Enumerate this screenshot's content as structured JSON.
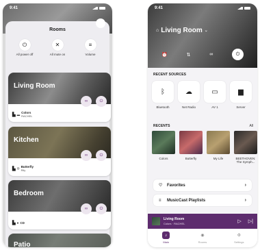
{
  "status": {
    "time": "9:41"
  },
  "left": {
    "rooms_title": "Rooms",
    "quick_actions": [
      {
        "label": "All power off",
        "icon": "power-icon",
        "glyph": "⏻"
      },
      {
        "label": "All mute on",
        "icon": "mute-icon",
        "glyph": "🔇"
      },
      {
        "label": "Volume",
        "icon": "volume-sliders-icon",
        "glyph": "≡"
      }
    ],
    "rooms": [
      {
        "name": "Living Room",
        "track": "Colors",
        "artist": "RACHEL"
      },
      {
        "name": "Kitchen",
        "track": "Butterfly",
        "artist": "Rily"
      },
      {
        "name": "Bedroom",
        "track": "CD",
        "artist": ""
      },
      {
        "name": "Patio",
        "track": "",
        "artist": ""
      }
    ]
  },
  "right": {
    "room_title": "Living Room",
    "recent_sources_label": "RECENT SOURCES",
    "sources": [
      {
        "label": "Bluetooth",
        "icon": "bluetooth-icon",
        "glyph": "ᛒ"
      },
      {
        "label": "Net Radio",
        "icon": "net-radio-icon",
        "glyph": "☁"
      },
      {
        "label": "AV 1",
        "icon": "av-input-icon",
        "glyph": "▭"
      },
      {
        "label": "Server",
        "icon": "server-folder-icon",
        "glyph": "▆"
      }
    ],
    "recents_label": "RECENTS",
    "recents_all": "All",
    "recents": [
      {
        "label": "Colors",
        "label2": ""
      },
      {
        "label": "Butterfly",
        "label2": ""
      },
      {
        "label": "My Life",
        "label2": ""
      },
      {
        "label": "BEETHOVEN:",
        "label2": "The Symph..."
      }
    ],
    "favorites_label": "Favorites",
    "playlists_label": "MusicCast Playlists",
    "mini": {
      "room": "Living Room",
      "track": "Colors · RACHEL"
    },
    "tabs": [
      {
        "label": "Main",
        "icon": "main-tab-icon",
        "glyph": "♪",
        "active": true
      },
      {
        "label": "Rooms",
        "icon": "rooms-tab-icon",
        "glyph": "◉",
        "active": false
      },
      {
        "label": "Settings",
        "icon": "settings-tab-icon",
        "glyph": "⚙",
        "active": false
      }
    ],
    "colors": {
      "accent": "#5d2c6e"
    }
  }
}
